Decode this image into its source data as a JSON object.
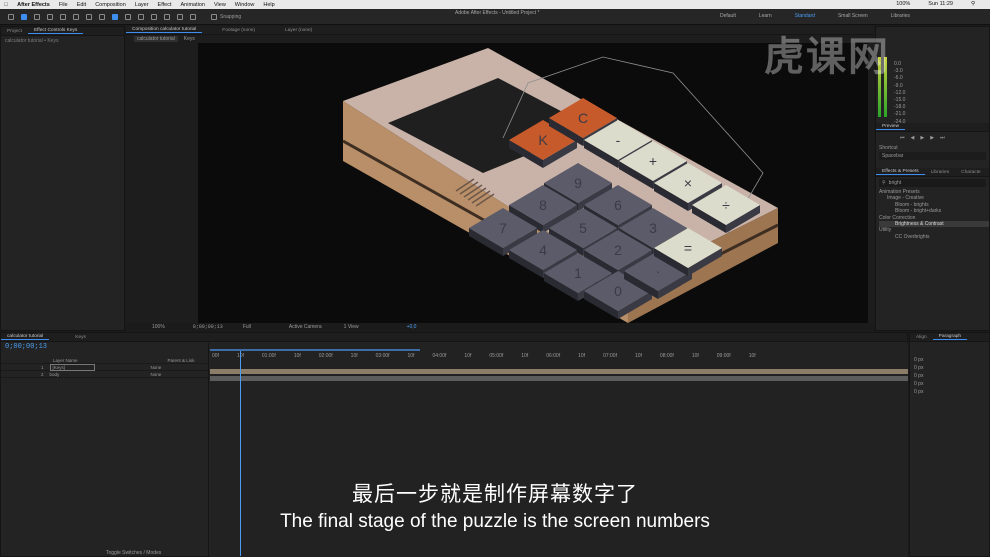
{
  "menubar": {
    "app": "After Effects",
    "items": [
      "File",
      "Edit",
      "Composition",
      "Layer",
      "Effect",
      "Animation",
      "View",
      "Window",
      "Help"
    ],
    "battery": "100%",
    "clock": "Sun 11:29"
  },
  "toolbar": {
    "window_title": "Adobe After Effects - Untitled Project *",
    "snapping_label": "Snapping",
    "workspaces": [
      "Default",
      "Learn",
      "Standard",
      "Small Screen",
      "Libraries"
    ],
    "active_workspace": "Standard",
    "search_label": "Search Help"
  },
  "left_panel": {
    "tabs": [
      "Project",
      "Effect Controls Keys"
    ],
    "subtitle": "calculator tutorial • Keys"
  },
  "comp_panel": {
    "tabs": [
      "Composition calculator tutorial",
      "Footage (none)",
      "Layer (none)"
    ],
    "subtabs": [
      "calculator tutorial",
      "Keys"
    ],
    "footer": {
      "zoom": "100%",
      "time": "0;00;00;13",
      "resolution": "Full",
      "camera": "Active Camera",
      "views": "1 View",
      "offset": "+0,0"
    }
  },
  "right_panel": {
    "audio_levels": [
      "0.0",
      "-3.0",
      "-6.0",
      "-9.0",
      "-12.0",
      "-15.0",
      "-18.0",
      "-21.0",
      "-24.0"
    ],
    "preview_tab": "Preview",
    "shortcut_label": "Shortcut",
    "shortcut_value": "Spacebar",
    "tabs": [
      "Effects & Presets",
      "Libraries",
      "Characte"
    ],
    "search_value": "bright",
    "tree": [
      "Animation Presets",
      "Image - Creative",
      "Bloom - brights",
      "Bloom - bright+darks",
      "Color Correction",
      "Brightness & Contrast",
      "Utility",
      "CC Overbrights"
    ]
  },
  "timeline": {
    "tabs": [
      "calculator tutorial",
      "Keys"
    ],
    "timecode": "0;00;00;13",
    "columns": [
      "Layer Name",
      "Parent & Link"
    ],
    "layers": [
      {
        "num": "1",
        "name": "[Keys]",
        "parent": "None"
      },
      {
        "num": "2",
        "name": "body",
        "parent": "None"
      }
    ],
    "ruler": [
      "00f",
      "10f",
      "01:00f",
      "10f",
      "02:00f",
      "10f",
      "03:00f",
      "10f",
      "04:00f",
      "10f",
      "05:00f",
      "10f",
      "06:00f",
      "10f",
      "07:00f",
      "10f",
      "08:00f",
      "10f",
      "09:00f",
      "10f"
    ],
    "footer_label": "Toggle Switches / Modes"
  },
  "align_panel": {
    "tabs": [
      "Align",
      "Paragraph"
    ],
    "values": [
      "0 px",
      "0 px",
      "0 px",
      "0 px",
      "0 px"
    ]
  },
  "calculator": {
    "display_keys": [
      "K",
      "C"
    ],
    "keys": [
      "9",
      "8",
      "7",
      "6",
      "5",
      "4",
      "3",
      "2",
      "1",
      "0",
      "·",
      "+",
      "×",
      "÷",
      "-",
      "="
    ]
  },
  "subtitles": {
    "chinese": "最后一步就是制作屏幕数字了",
    "english": "The final stage of the puzzle is the screen numbers"
  },
  "watermark": "虎课网"
}
